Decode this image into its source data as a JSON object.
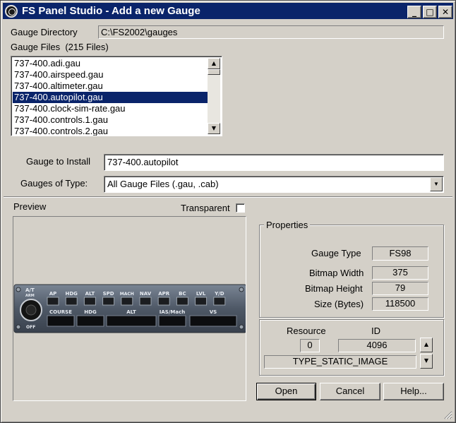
{
  "window": {
    "title": "FS Panel Studio - Add a new Gauge",
    "min_icon": "minimize-icon",
    "max_icon": "maximize-icon",
    "close_icon": "close-icon",
    "min_glyph": "_",
    "max_glyph": "□",
    "close_glyph": "✕"
  },
  "gauge_directory": {
    "label": "Gauge Directory",
    "value": "C:\\FS2002\\gauges"
  },
  "gauge_files": {
    "label": "Gauge Files",
    "count_text": "(215 Files)",
    "items": [
      "737-400.adi.gau",
      "737-400.airspeed.gau",
      "737-400.altimeter.gau",
      "737-400.autopilot.gau",
      "737-400.clock-sim-rate.gau",
      "737-400.controls.1.gau",
      "737-400.controls.2.gau"
    ],
    "selected_index": 3
  },
  "install": {
    "label": "Gauge to Install",
    "value": "737-400.autopilot"
  },
  "type_filter": {
    "label": "Gauges of Type:",
    "selected": "All Gauge Files (.gau, .cab)"
  },
  "preview": {
    "label": "Preview",
    "transparent_label": "Transparent",
    "transparent_checked": false,
    "gauge_labels": {
      "at": "A/T",
      "arm": "ARM",
      "off": "OFF",
      "buttons": [
        "AP",
        "HDG",
        "ALT",
        "SPD",
        "MACH",
        "NAV",
        "APR",
        "BC",
        "LVL",
        "Y/D"
      ],
      "displays": [
        "COURSE",
        "HDG",
        "ALT",
        "IAS/Mach",
        "VS"
      ]
    }
  },
  "properties": {
    "title": "Properties",
    "gauge_type_label": "Gauge Type",
    "gauge_type_value": "FS98",
    "bitmap_width_label": "Bitmap Width",
    "bitmap_width_value": "375",
    "bitmap_height_label": "Bitmap Height",
    "bitmap_height_value": "79",
    "size_label": "Size (Bytes)",
    "size_value": "118500"
  },
  "resource": {
    "resource_label": "Resource",
    "id_label": "ID",
    "resource_value": "0",
    "id_value": "4096",
    "type_value": "TYPE_STATIC_IMAGE"
  },
  "buttons": {
    "open": "Open",
    "cancel": "Cancel",
    "help": "Help..."
  },
  "colors": {
    "titlebar": "#0a246a",
    "window_bg": "#d4d0c8",
    "selection": "#0a246a",
    "gauge_panel": "#4e5866"
  }
}
